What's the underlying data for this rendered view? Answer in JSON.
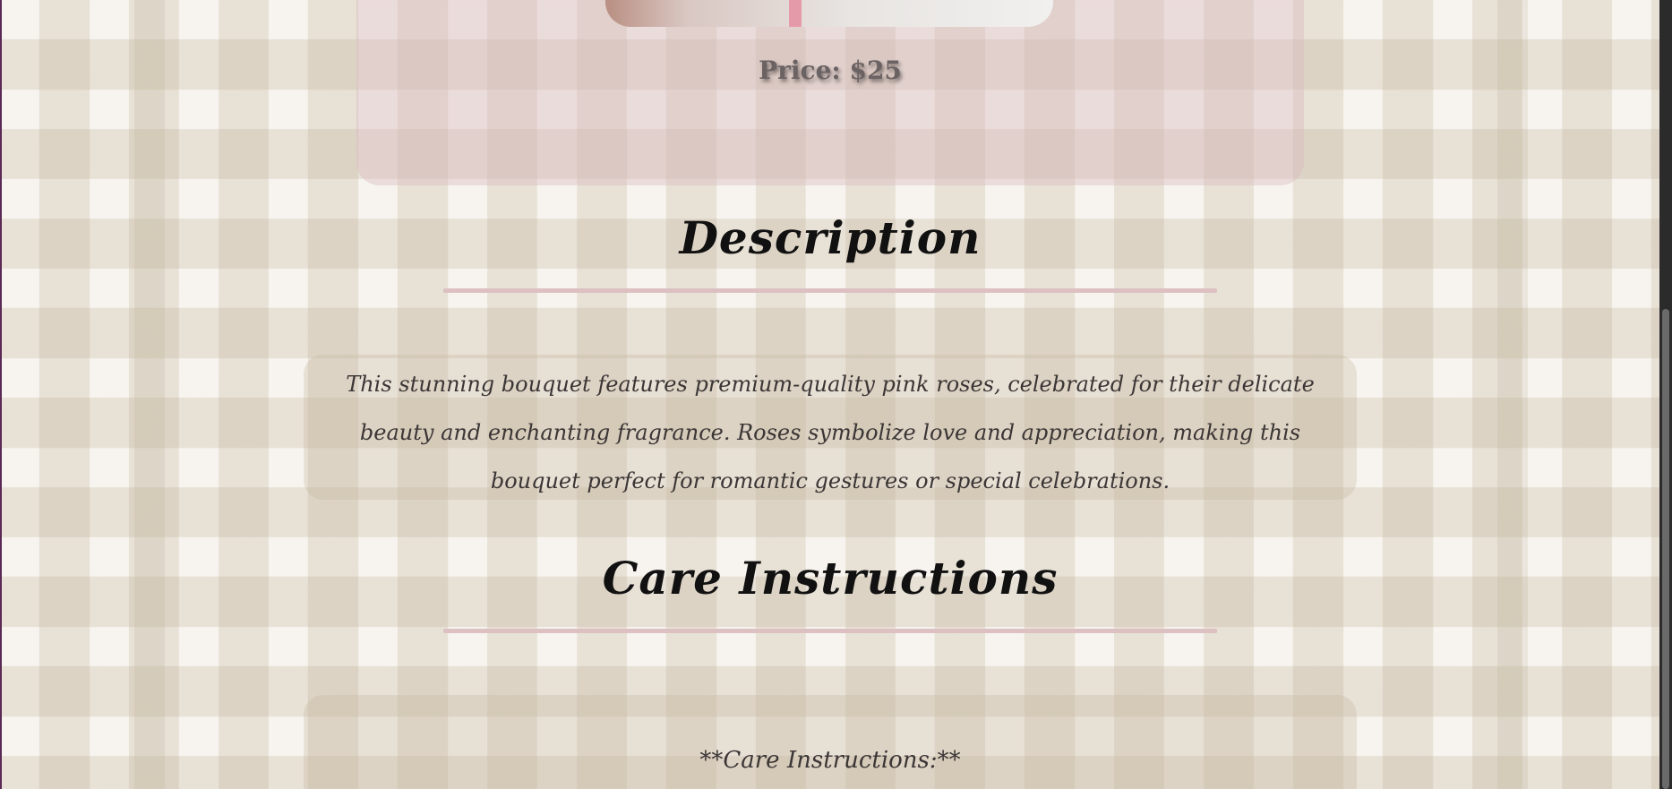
{
  "product": {
    "price_label": "Price: $25"
  },
  "description": {
    "heading": "Description",
    "text": "This stunning bouquet features premium-quality pink roses, celebrated for their delicate beauty and enchanting fragrance. Roses symbolize love and appreciation, making this bouquet perfect for romantic gestures or special celebrations."
  },
  "care": {
    "heading": "Care Instructions",
    "text": "**Care Instructions:**"
  },
  "colors": {
    "card_pink": "#d9b9be",
    "divider": "#dcc0c2",
    "heading_text": "#111111",
    "body_text": "#3b3636"
  }
}
